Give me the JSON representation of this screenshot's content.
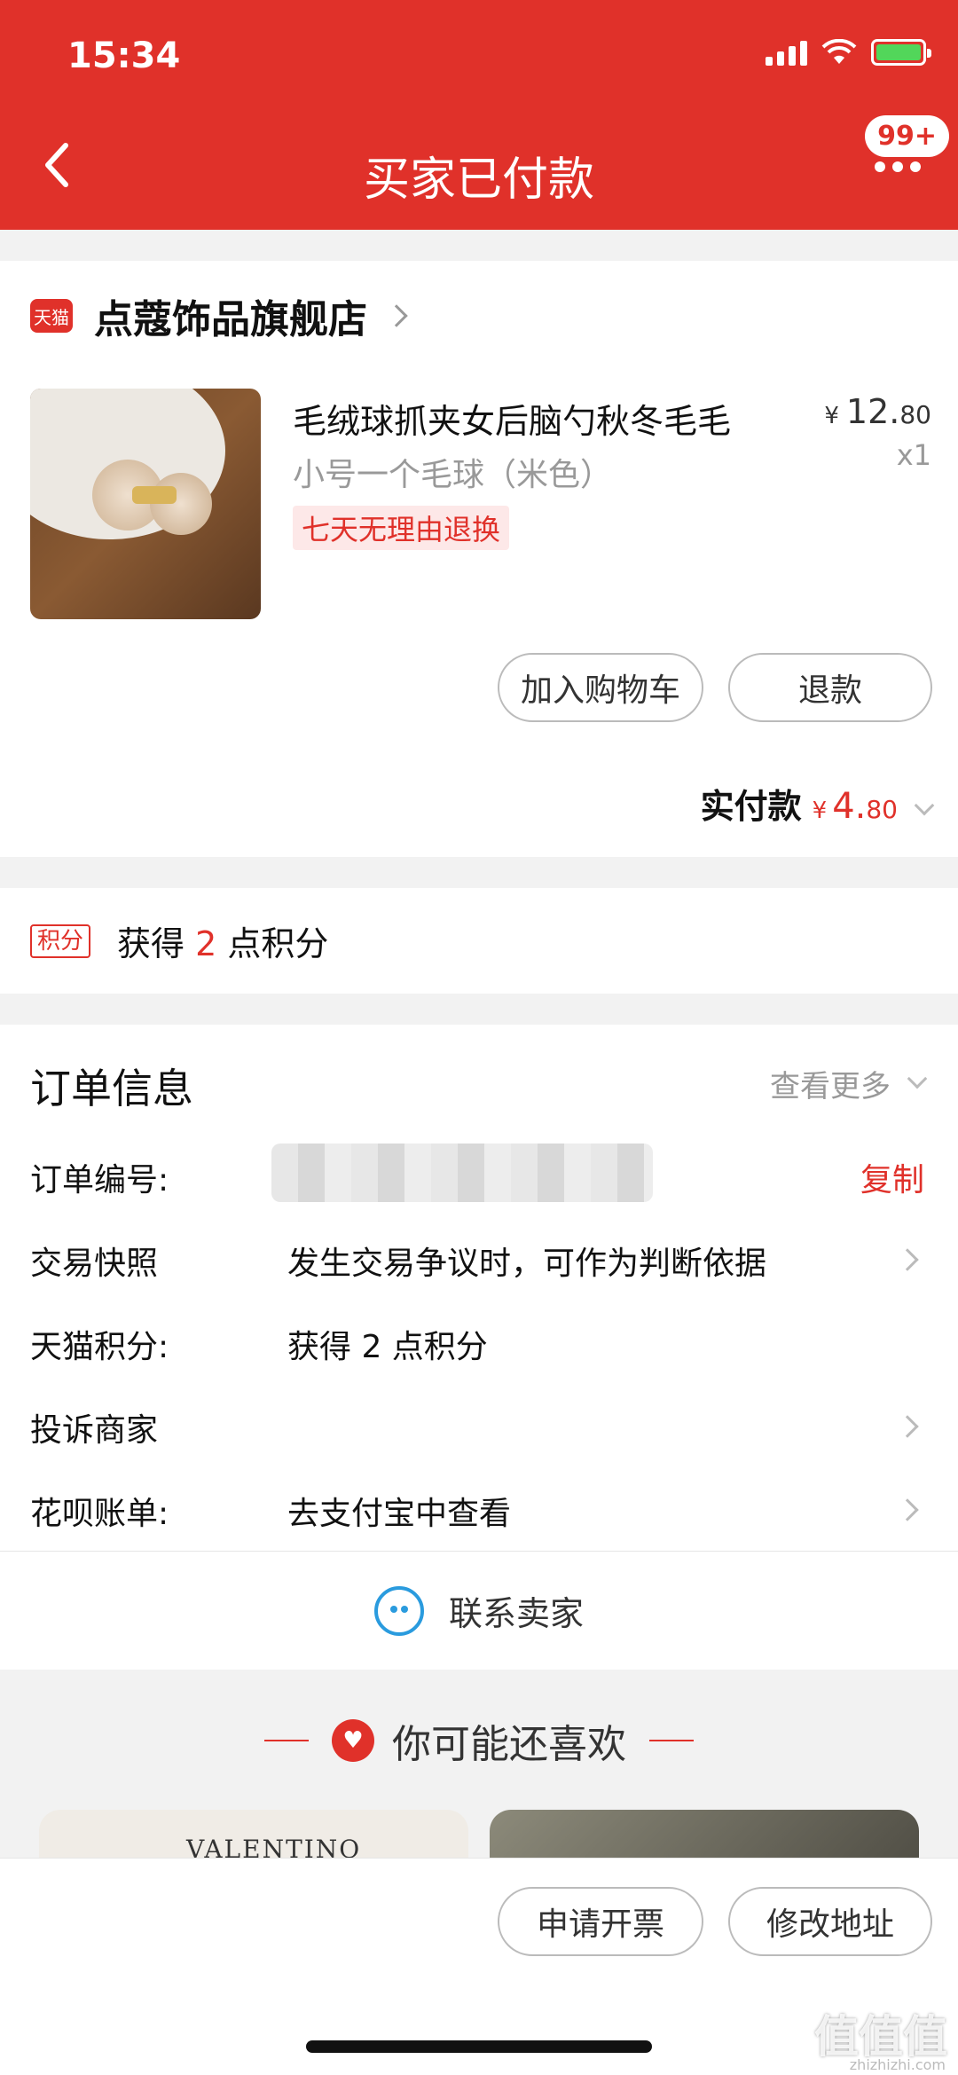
{
  "status": {
    "time": "15:34"
  },
  "header": {
    "title": "买家已付款",
    "badge": "99+"
  },
  "shop": {
    "badge": "天猫",
    "name": "点蔻饰品旗舰店"
  },
  "product": {
    "title": "毛绒球抓夹女后脑勺秋冬毛毛",
    "sku": "小号一个毛球（米色）",
    "tag": "七天无理由退换",
    "price_currency": "¥",
    "price_int": "12.",
    "price_dec": "80",
    "qty": "x1"
  },
  "actions": {
    "add_cart": "加入购物车",
    "refund": "退款"
  },
  "paid": {
    "label": "实付款",
    "currency": "¥",
    "int": "4.",
    "dec": "80"
  },
  "points": {
    "badge": "积分",
    "prefix": "获得",
    "amount": "2",
    "suffix": "点积分"
  },
  "order_info": {
    "title": "订单信息",
    "more": "查看更多",
    "rows": [
      {
        "key": "订单编号:",
        "value": "",
        "action": "复制"
      },
      {
        "key": "交易快照",
        "value": "发生交易争议时，可作为判断依据"
      },
      {
        "key": "天猫积分:",
        "value": "获得 2 点积分"
      },
      {
        "key": "投诉商家",
        "value": ""
      },
      {
        "key": "花呗账单:",
        "value": "去支付宝中查看"
      }
    ]
  },
  "contact": {
    "label": "联系卖家"
  },
  "recommend": {
    "title": "你可能还喜欢",
    "card1_text": "VALENTINO"
  },
  "bottom": {
    "invoice": "申请开票",
    "address": "修改地址"
  },
  "watermark": {
    "main": "值值值",
    "sub": "zhizhizhi.com"
  },
  "colors": {
    "brand_red": "#e0312a",
    "link_blue": "#2a9bde"
  }
}
